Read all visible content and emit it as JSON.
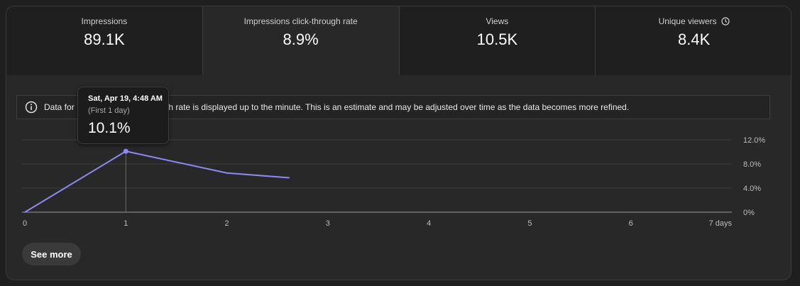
{
  "metrics": [
    {
      "label": "Impressions",
      "value": "89.1K"
    },
    {
      "label": "Impressions click-through rate",
      "value": "8.9%"
    },
    {
      "label": "Views",
      "value": "10.5K"
    },
    {
      "label": "Unique viewers",
      "value": "8.4K"
    }
  ],
  "info": {
    "text": "Data for Impressions click-through rate is displayed up to the minute. This is an estimate and may be adjusted over time as the data becomes more refined."
  },
  "tooltip": {
    "date": "Sat, Apr 19, 4:48 AM",
    "subtitle": "(First 1 day)",
    "value": "10.1%"
  },
  "see_more_label": "See more",
  "colors": {
    "line": "#8e88f5",
    "accent": "#8e88f5"
  },
  "chart_data": {
    "type": "line",
    "x": [
      0,
      1,
      2,
      2.62
    ],
    "y": [
      0,
      10.1,
      6.5,
      5.7
    ],
    "xlim": [
      0,
      7
    ],
    "ylim": [
      0,
      12
    ],
    "x_ticks": [
      0,
      1,
      2,
      3,
      4,
      5,
      6,
      7
    ],
    "x_tick_labels": [
      "0",
      "1",
      "2",
      "3",
      "4",
      "5",
      "6",
      "7 days"
    ],
    "y_ticks": [
      0,
      4,
      8,
      12
    ],
    "y_tick_labels": [
      "0%",
      "4.0%",
      "8.0%",
      "12.0%"
    ],
    "highlight_index": 1,
    "grid": true
  }
}
